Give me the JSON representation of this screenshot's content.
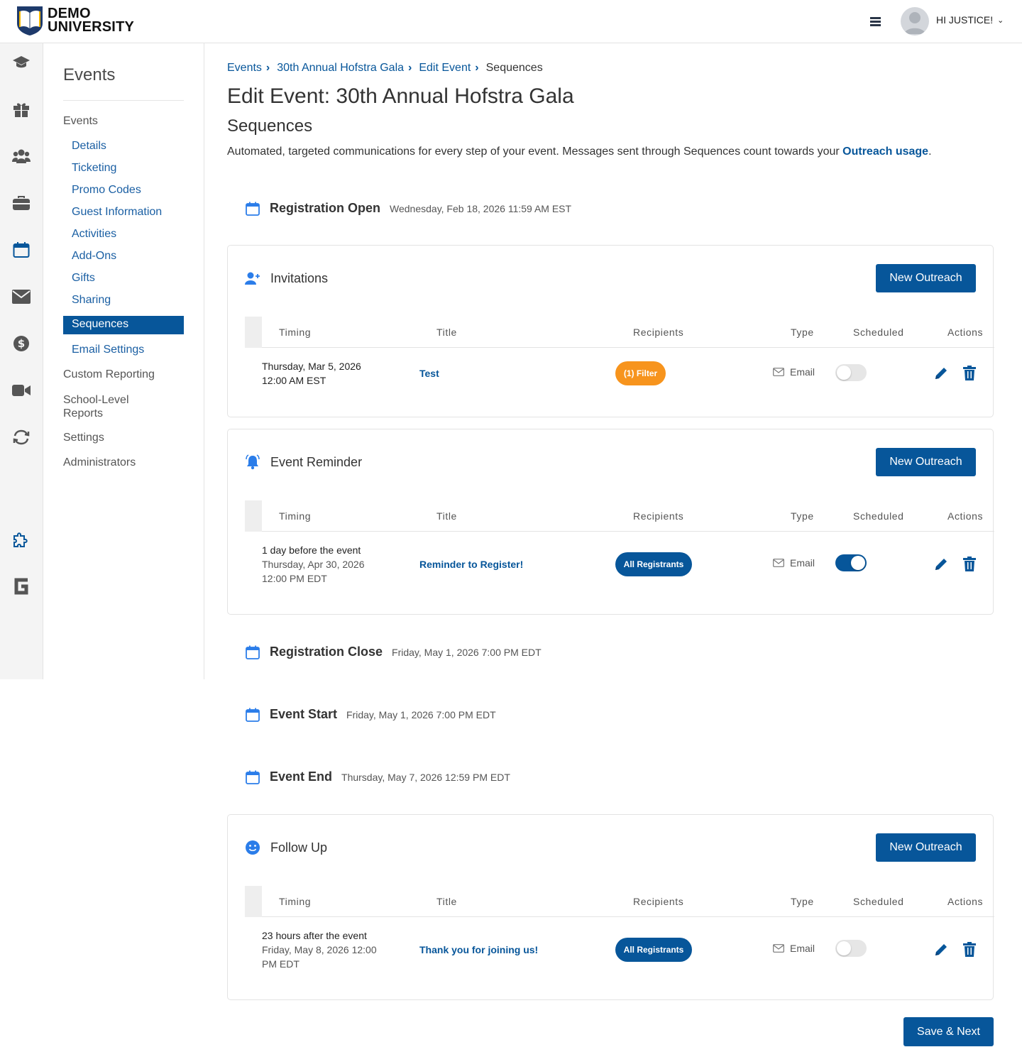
{
  "brand": {
    "line1": "DEMO",
    "line2": "UNIVERSITY"
  },
  "header": {
    "greeting": "HI JUSTICE!"
  },
  "rail_icons": [
    "graduation-cap-icon",
    "gift-icon",
    "users-icon",
    "briefcase-icon",
    "calendar-icon",
    "envelope-icon",
    "dollar-icon",
    "video-icon",
    "sync-icon",
    "puzzle-icon",
    "g-logo-icon"
  ],
  "sidenav": {
    "title": "Events",
    "group_events": "Events",
    "items": [
      "Details",
      "Ticketing",
      "Promo Codes",
      "Guest Information",
      "Activities",
      "Add-Ons",
      "Gifts",
      "Sharing"
    ],
    "active": "Sequences",
    "email_settings": "Email Settings",
    "custom_reporting": "Custom Reporting",
    "school_reports_1": "School-Level",
    "school_reports_2": "Reports",
    "settings": "Settings",
    "administrators": "Administrators"
  },
  "breadcrumb": {
    "b1": "Events",
    "b2": "30th Annual Hofstra Gala",
    "b3": "Edit Event",
    "current": "Sequences"
  },
  "page_title": "Edit Event: 30th Annual Hofstra Gala",
  "section_title": "Sequences",
  "description": {
    "text": "Automated, targeted communications for every step of your event. Messages sent through Sequences count towards your ",
    "link": "Outreach usage",
    "end": "."
  },
  "milestones": {
    "reg_open": {
      "label": "Registration Open",
      "date": "Wednesday, Feb 18, 2026 11:59 AM EST"
    },
    "reg_close": {
      "label": "Registration Close",
      "date": "Friday, May 1, 2026 7:00 PM EDT"
    },
    "event_start": {
      "label": "Event Start",
      "date": "Friday, May 1, 2026 7:00 PM EDT"
    },
    "event_end": {
      "label": "Event End",
      "date": "Thursday, May 7, 2026 12:59 PM EDT"
    }
  },
  "columns": {
    "timing": "Timing",
    "title": "Title",
    "recipients": "Recipients",
    "type": "Type",
    "scheduled": "Scheduled",
    "actions": "Actions"
  },
  "new_outreach": "New Outreach",
  "cards": {
    "invitations": {
      "title": "Invitations",
      "row": {
        "timing1": "Thursday, Mar 5, 2026",
        "timing2": "12:00 AM EST",
        "title": "Test",
        "recipients": "(1) Filter",
        "type": "Email",
        "scheduled": false
      }
    },
    "reminder": {
      "title": "Event Reminder",
      "row": {
        "timing1": "1 day before the event",
        "timing2": "Thursday, Apr 30, 2026",
        "timing3": "12:00 PM EDT",
        "title": "Reminder to Register!",
        "recipients": "All Registrants",
        "type": "Email",
        "scheduled": true
      }
    },
    "followup": {
      "title": "Follow Up",
      "row": {
        "timing1": "23 hours after the event",
        "timing2": "Friday, May 8, 2026 12:00",
        "timing3": "PM EDT",
        "title": "Thank you for joining us!",
        "recipients": "All Registrants",
        "type": "Email",
        "scheduled": false
      }
    }
  },
  "save_next": "Save & Next",
  "colors": {
    "primary": "#07569a",
    "orange": "#f7941d",
    "icon_blue": "#2b7de9"
  }
}
